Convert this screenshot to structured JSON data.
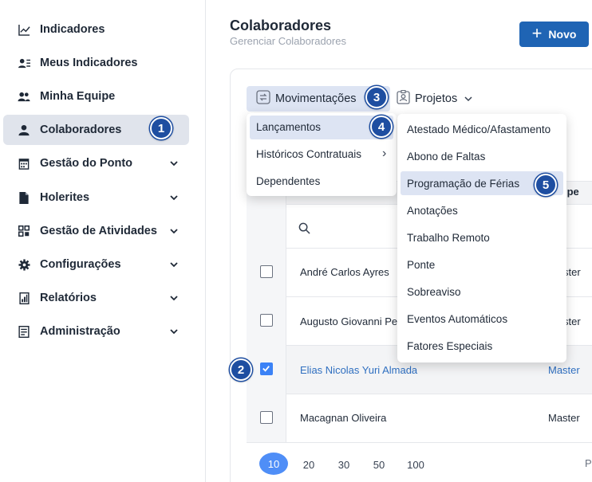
{
  "sidebar": {
    "items": [
      {
        "label": "Indicadores",
        "icon": "trend-chart-icon",
        "has_chevron": false
      },
      {
        "label": "Meus Indicadores",
        "icon": "person-list-icon",
        "has_chevron": false
      },
      {
        "label": "Minha Equipe",
        "icon": "team-icon",
        "has_chevron": false
      },
      {
        "label": "Colaboradores",
        "icon": "person-icon",
        "has_chevron": false,
        "active": true
      },
      {
        "label": "Gestão do Ponto",
        "icon": "calendar-icon",
        "has_chevron": true
      },
      {
        "label": "Holerites",
        "icon": "document-icon",
        "has_chevron": true
      },
      {
        "label": "Gestão de Atividades",
        "icon": "grid-icon",
        "has_chevron": true
      },
      {
        "label": "Configurações",
        "icon": "gear-icon",
        "has_chevron": true
      },
      {
        "label": "Relatórios",
        "icon": "report-icon",
        "has_chevron": true
      },
      {
        "label": "Administração",
        "icon": "admin-icon",
        "has_chevron": true
      }
    ]
  },
  "header": {
    "title": "Colaboradores",
    "subtitle": "Gerenciar Colaboradores",
    "new_button": "Novo"
  },
  "tabs": {
    "movimentacoes": "Movimentações",
    "projetos": "Projetos"
  },
  "menu_primary": {
    "items": [
      "Lançamentos",
      "Históricos Contratuais",
      "Dependentes"
    ],
    "submenu_arrow": "›"
  },
  "menu_secondary": {
    "items": [
      "Atestado Médico/Afastamento",
      "Abono de Faltas",
      "Programação de Férias",
      "Anotações",
      "Trabalho Remoto",
      "Ponte",
      "Sobreaviso",
      "Eventos Automáticos",
      "Fatores Especiais"
    ]
  },
  "table": {
    "team_header": "ipe",
    "rows": [
      {
        "name": "André Carlos Ayres",
        "team": "ster",
        "checked": false
      },
      {
        "name": "Augusto Giovanni Pe",
        "team": "ster",
        "checked": false
      },
      {
        "name": "Elias Nicolas Yuri Almada",
        "team": "Master",
        "checked": true
      },
      {
        "name": "Macagnan Oliveira",
        "team": "Master",
        "checked": false
      }
    ]
  },
  "pagination": {
    "sizes": [
      "10",
      "20",
      "30",
      "50",
      "100"
    ],
    "active": "10",
    "trailing": "P"
  },
  "badges": [
    "1",
    "2",
    "3",
    "4",
    "5"
  ],
  "colors": {
    "primary": "#1f64b4",
    "badge": "#1e4ea1",
    "highlight": "#dde4f3",
    "link": "#2f6fc0",
    "checkbox": "#3b82f6"
  }
}
